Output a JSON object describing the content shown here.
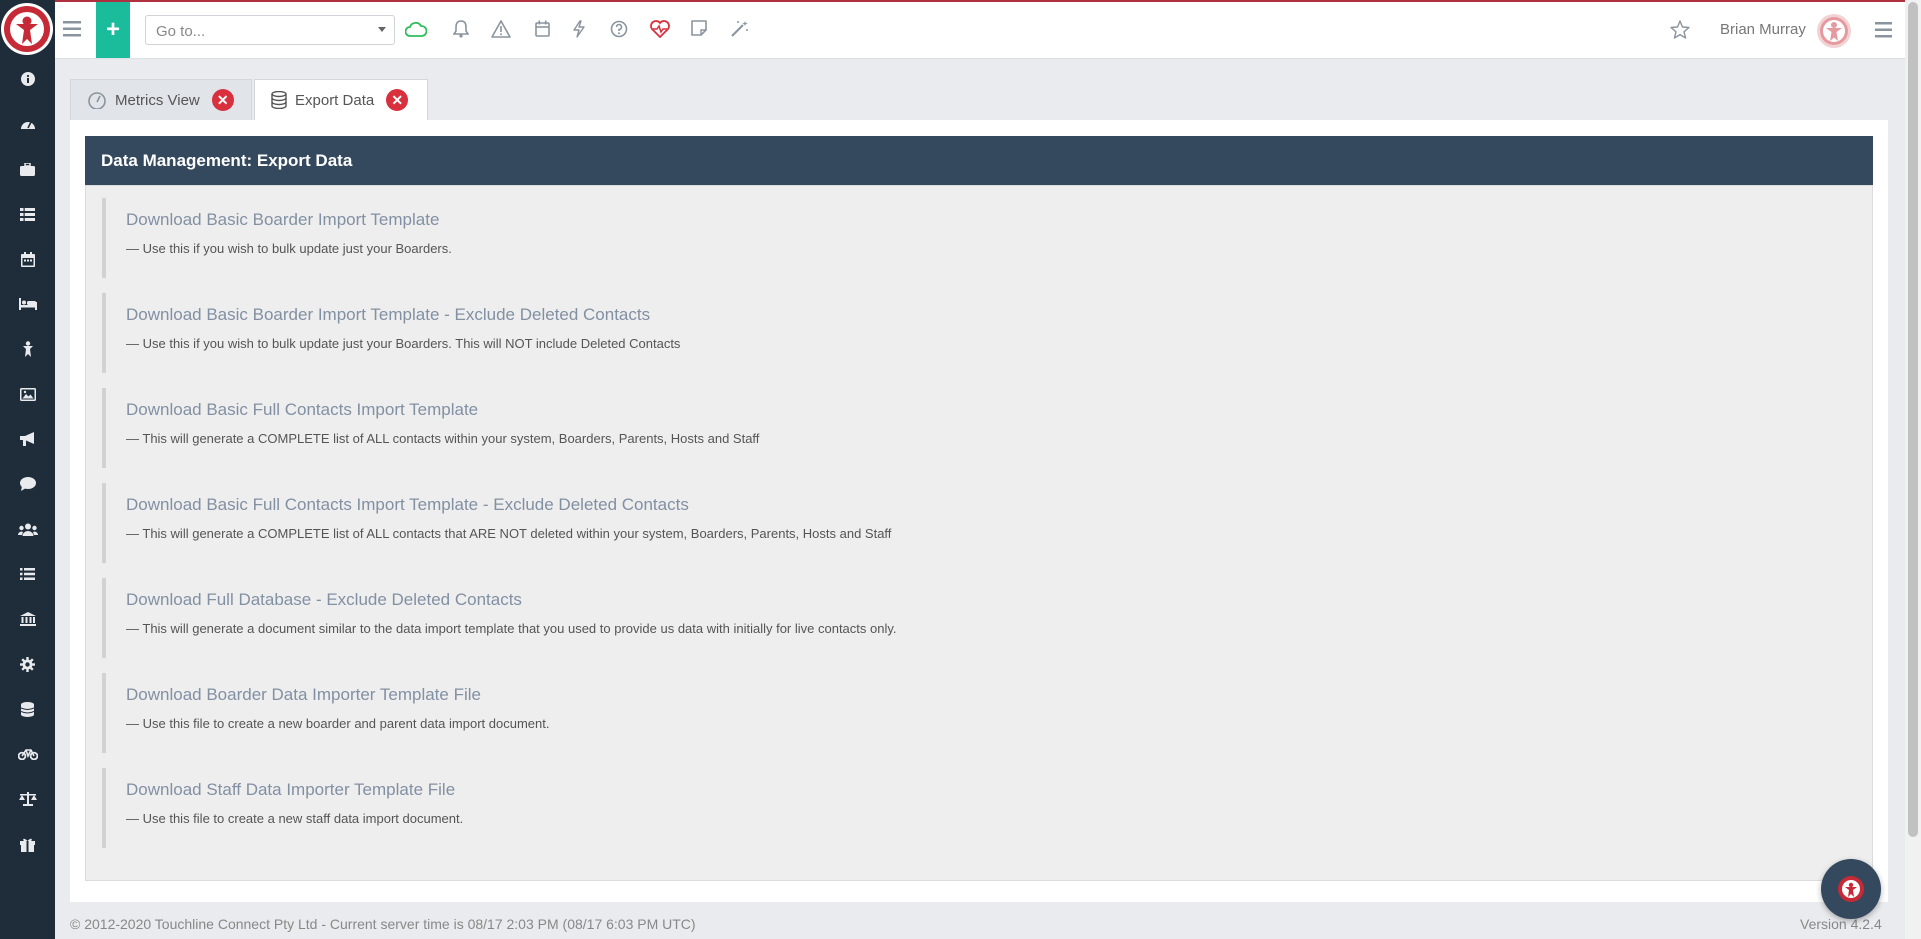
{
  "header": {
    "goto_placeholder": "Go to...",
    "user_name": "Brian Murray",
    "icons": [
      "menu-icon",
      "plus-icon",
      "cloud-icon",
      "bell-icon",
      "warning-icon",
      "calendar-icon",
      "bolt-icon",
      "help-icon",
      "heartbeat-icon",
      "note-icon",
      "magic-wand-icon",
      "star-icon",
      "avatar",
      "right-menu-icon"
    ]
  },
  "sidebar": {
    "icons": [
      "info-icon",
      "dashboard-icon",
      "briefcase-icon",
      "list-table-icon",
      "calendar-icon",
      "bed-icon",
      "person-icon",
      "image-icon",
      "megaphone-icon",
      "chat-icon",
      "users-icon",
      "list-icon",
      "bank-icon",
      "gear-icon",
      "database-icon",
      "bicycle-icon",
      "scales-icon",
      "gift-icon"
    ]
  },
  "tabs": [
    {
      "label": "Metrics View",
      "icon": "gauge-icon",
      "active": false
    },
    {
      "label": "Export Data",
      "icon": "database-icon",
      "active": true
    }
  ],
  "panel": {
    "title": "Data Management: Export Data",
    "items": [
      {
        "link": "Download Basic Boarder Import Template",
        "desc": "— Use this if you wish to bulk update just your Boarders."
      },
      {
        "link": "Download Basic Boarder Import Template - Exclude Deleted Contacts",
        "desc": "— Use this if you wish to bulk update just your Boarders. This will NOT include Deleted Contacts"
      },
      {
        "link": "Download Basic Full Contacts Import Template",
        "desc": "— This will generate a COMPLETE list of ALL contacts within your system, Boarders, Parents, Hosts and Staff"
      },
      {
        "link": "Download Basic Full Contacts Import Template - Exclude Deleted Contacts",
        "desc": "— This will generate a COMPLETE list of ALL contacts that ARE NOT deleted within your system, Boarders, Parents, Hosts and Staff"
      },
      {
        "link": "Download Full Database - Exclude Deleted Contacts",
        "desc": "— This will generate a document similar to the data import template that you used to provide us data with initially for live contacts only."
      },
      {
        "link": "Download Boarder Data Importer Template File",
        "desc": "— Use this file to create a new boarder and parent data import document."
      },
      {
        "link": "Download Staff Data Importer Template File",
        "desc": "— Use this file to create a new staff data import document."
      }
    ]
  },
  "footer": {
    "copyright": "© 2012-2020 Touchline Connect Pty Ltd - Current server time is 08/17 2:03 PM (08/17 6:03 PM UTC)",
    "version": "Version 4.2.4"
  },
  "colors": {
    "sidebar": "#1f2d3a",
    "accent_green": "#1abc9c",
    "brand_red": "#c62a36",
    "panel_header": "#34495e",
    "link": "#8290a3"
  }
}
